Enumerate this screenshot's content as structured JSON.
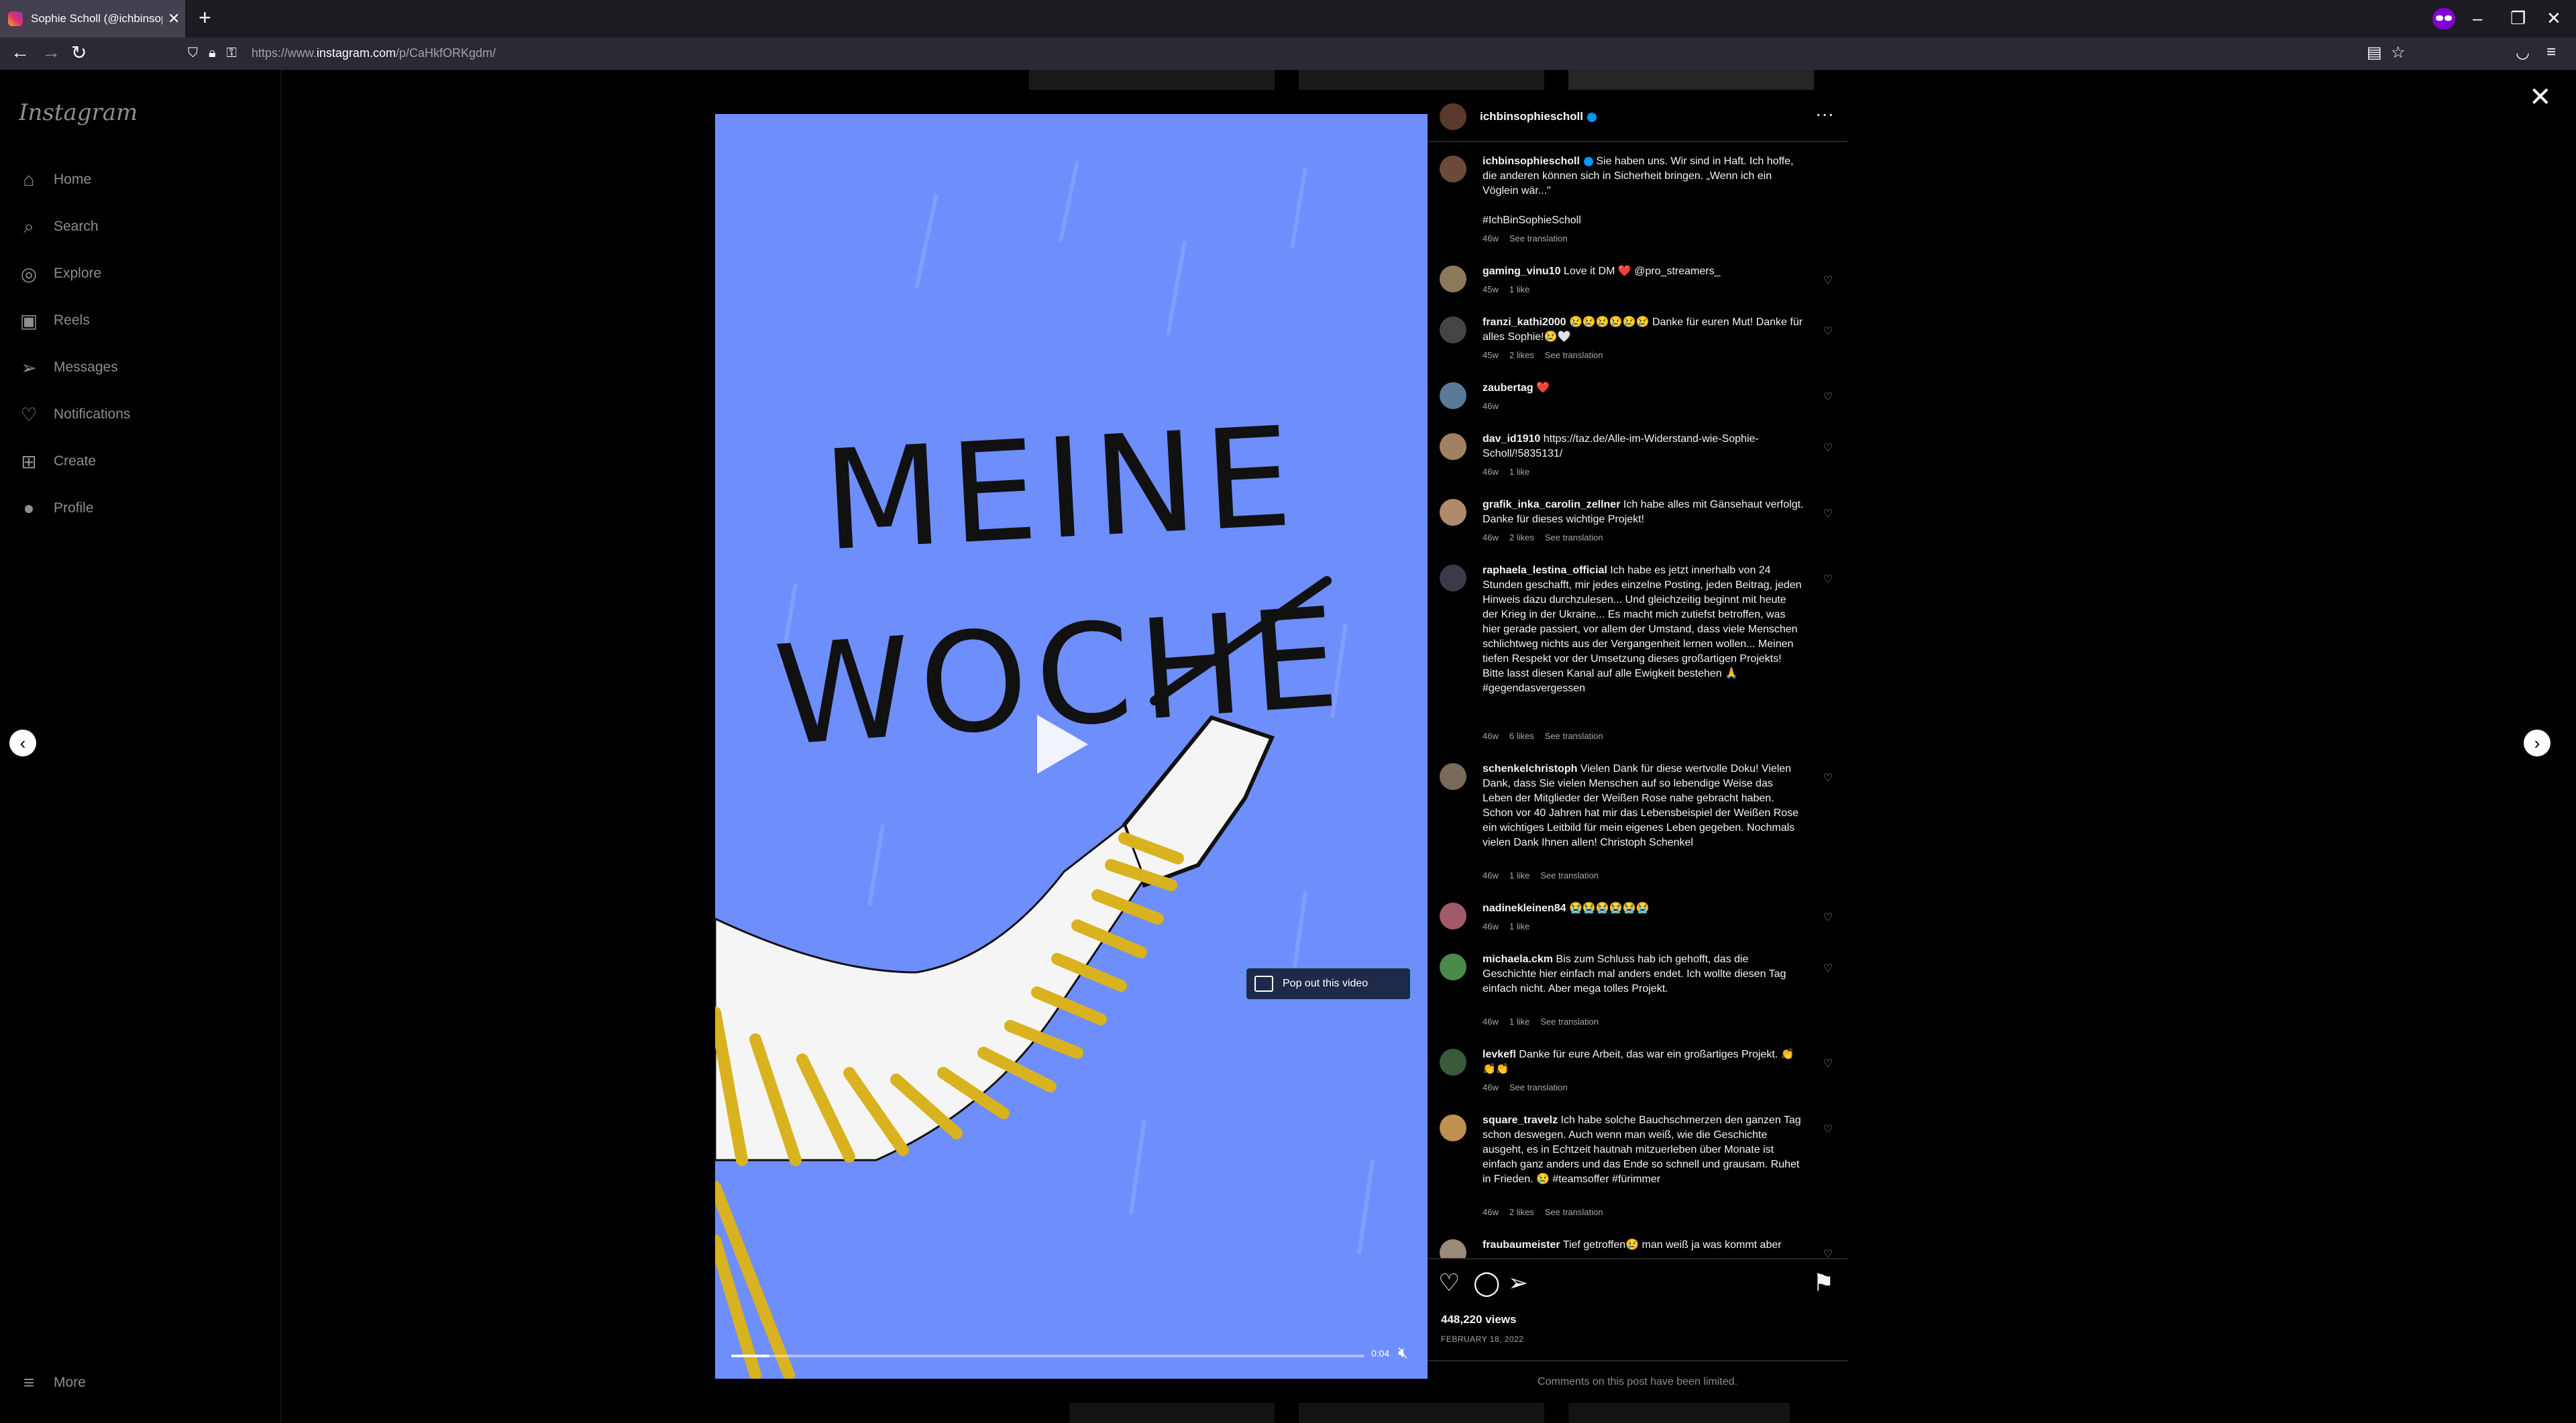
{
  "browser": {
    "tab_title": "Sophie Scholl (@ichbinsophiescholl)",
    "url_prefix": "https://www.",
    "url_domain": "instagram.com",
    "url_path": "/p/CaHkfORKgdm/"
  },
  "sidebar": {
    "logo": "Instagram",
    "items": [
      {
        "label": "Home",
        "icon": "home-icon"
      },
      {
        "label": "Search",
        "icon": "search-icon"
      },
      {
        "label": "Explore",
        "icon": "compass-icon"
      },
      {
        "label": "Reels",
        "icon": "reels-icon"
      },
      {
        "label": "Messages",
        "icon": "paper-plane-icon"
      },
      {
        "label": "Notifications",
        "icon": "heart-icon"
      },
      {
        "label": "Create",
        "icon": "plus-square-icon"
      },
      {
        "label": "Profile",
        "icon": "avatar-icon"
      }
    ],
    "more": "More"
  },
  "video": {
    "art_line1": "MEINE",
    "art_line2": "WOCHE",
    "popout_label": "Pop out this video",
    "timecode": "0:04",
    "progress": 0.06,
    "background_color": "#6e8efb",
    "stripe_color": "#d9b21f"
  },
  "post": {
    "username": "ichbinsophiescholl",
    "caption": {
      "username": "ichbinsophiescholl",
      "text": "Sie haben uns. Wir sind in Haft. Ich hoffe, die anderen können sich in Sicherheit bringen. „Wenn ich ein Vöglein wär...\"",
      "hashtag": "#IchBinSophieScholl",
      "age": "46w",
      "translate": "See translation"
    },
    "comments": [
      {
        "user": "gaming_vinu10",
        "text": "Love it DM ❤️ @pro_streamers_",
        "age": "45w",
        "likes": "1 like",
        "translate": ""
      },
      {
        "user": "franzi_kathi2000",
        "text": "😢😢😢😢😢😢 Danke für euren Mut! Danke für alles Sophie!😢🤍",
        "age": "45w",
        "likes": "2 likes",
        "translate": "See translation"
      },
      {
        "user": "zaubertag",
        "text": "❤️",
        "age": "46w",
        "likes": "",
        "translate": ""
      },
      {
        "user": "dav_id1910",
        "text": "https://taz.de/Alle-im-Widerstand-wie-Sophie-Scholl/!5835131/",
        "age": "46w",
        "likes": "1 like",
        "translate": ""
      },
      {
        "user": "grafik_inka_carolin_zellner",
        "text": "Ich habe alles mit Gänsehaut verfolgt. Danke für dieses wichtige Projekt!",
        "age": "46w",
        "likes": "2 likes",
        "translate": "See translation"
      },
      {
        "user": "raphaela_lestina_official",
        "text": "Ich habe es jetzt innerhalb von 24 Stunden geschafft, mir jedes einzelne Posting, jeden Beitrag, jeden Hinweis dazu durchzulesen... Und gleichzeitig beginnt mit heute der Krieg in der Ukraine... Es macht mich zutiefst betroffen, was hier gerade passiert, vor allem der Umstand, dass viele Menschen schlichtweg nichts aus der Vergangenheit lernen wollen... Meinen tiefen Respekt vor der Umsetzung dieses großartigen Projekts! Bitte lasst diesen Kanal auf alle Ewigkeit bestehen 🙏 #gegendasvergessen",
        "age": "46w",
        "likes": "6 likes",
        "translate": "See translation"
      },
      {
        "user": "schenkelchristoph",
        "text": "Vielen Dank für diese wertvolle Doku! Vielen Dank, dass Sie vielen Menschen auf so lebendige Weise das Leben der Mitglieder der Weißen Rose nahe gebracht haben. Schon vor 40 Jahren hat mir das Lebensbeispiel der Weißen Rose ein wichtiges Leitbild für mein eigenes Leben gegeben. Nochmals vielen Dank Ihnen allen! Christoph Schenkel",
        "age": "46w",
        "likes": "1 like",
        "translate": "See translation"
      },
      {
        "user": "nadinekleinen84",
        "text": "😭😭😭😭😭😭",
        "age": "46w",
        "likes": "1 like",
        "translate": ""
      },
      {
        "user": "michaela.ckm",
        "text": "Bis zum Schluss hab ich gehofft, das die Geschichte hier einfach mal anders endet. Ich wollte diesen Tag einfach nicht. Aber mega tolles Projekt.",
        "age": "46w",
        "likes": "1 like",
        "translate": "See translation"
      },
      {
        "user": "levkefl",
        "text": "Danke für eure Arbeit, das war ein großartiges Projekt. 👏👏👏",
        "age": "46w",
        "likes": "",
        "translate": "See translation"
      },
      {
        "user": "square_travelz",
        "text": "Ich habe solche Bauchschmerzen den ganzen Tag schon deswegen. Auch wenn man weiß, wie die Geschichte ausgeht, es in Echtzeit hautnah mitzuerleben über Monate ist einfach ganz anders und das Ende so schnell und grausam. Ruhet in Frieden. 😢 #teamsoffer #fürimmer",
        "age": "46w",
        "likes": "2 likes",
        "translate": "See translation"
      },
      {
        "user": "fraubaumeister",
        "text": "Tief getroffen😢 man weiß ja was kommt aber",
        "age": "",
        "likes": "",
        "translate": ""
      }
    ],
    "views": "448,220 views",
    "date": "FEBRUARY 18, 2022",
    "comments_limited": "Comments on this post have been limited."
  }
}
